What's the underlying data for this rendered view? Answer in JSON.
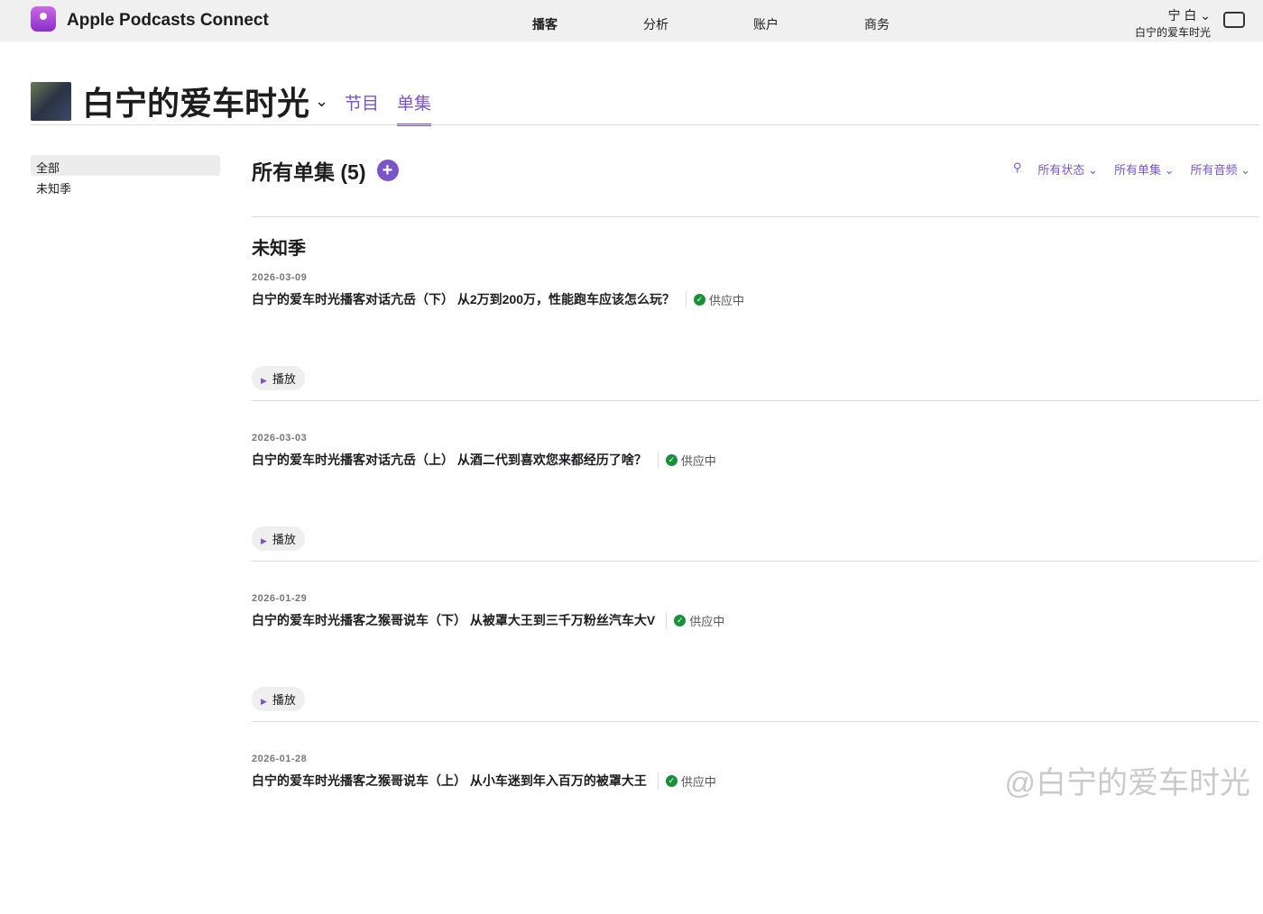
{
  "app": {
    "title": "Apple Podcasts Connect"
  },
  "nav": [
    "播客",
    "分析",
    "账户",
    "商务"
  ],
  "user": {
    "name": "宁 白",
    "show": "白宁的爱车时光"
  },
  "show": {
    "title": "白宁的爱车时光",
    "tabs": [
      "节目",
      "单集"
    ]
  },
  "sidebar": [
    "全部",
    "未知季"
  ],
  "main": {
    "title": "所有单集 (5)",
    "filters": [
      "所有状态",
      "所有单集",
      "所有音频"
    ],
    "season": "未知季",
    "play_label": "播放",
    "episodes": [
      {
        "date": "2026-03-09",
        "title": "白宁的爱车时光播客对话亢岳（下） 从2万到200万，性能跑车应该怎么玩？",
        "status": "供应中"
      },
      {
        "date": "2026-03-03",
        "title": "白宁的爱车时光播客对话亢岳（上） 从酒二代到喜欢您来都经历了啥？",
        "status": "供应中"
      },
      {
        "date": "2026-01-29",
        "title": "白宁的爱车时光播客之猴哥说车（下） 从被罩大王到三千万粉丝汽车大V",
        "status": "供应中"
      },
      {
        "date": "2026-01-28",
        "title": "白宁的爱车时光播客之猴哥说车（上） 从小车迷到年入百万的被罩大王",
        "status": "供应中"
      }
    ]
  },
  "watermark": "@白宁的爱车时光"
}
